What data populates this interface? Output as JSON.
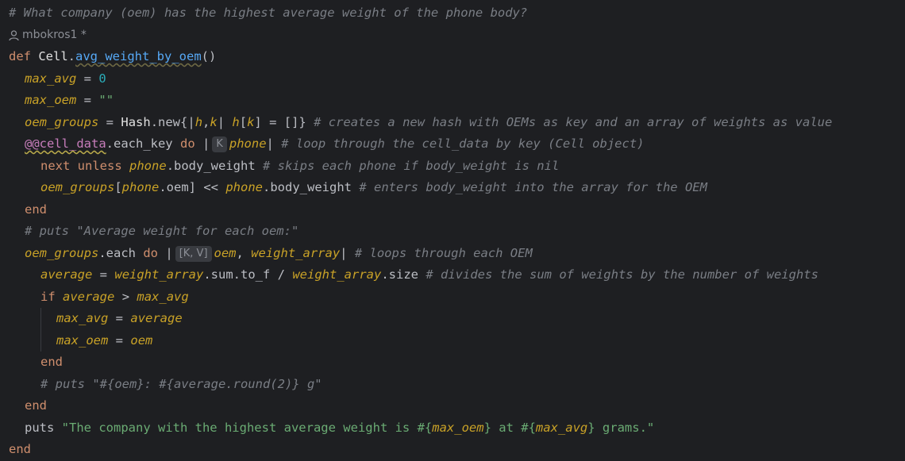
{
  "code": {
    "question_comment": "# What company (oem) has the highest average weight of the phone body?",
    "author": "mbokros1 *",
    "def_kw": "def",
    "def_class": "Cell",
    "def_method": "avg_weight_by_oem",
    "def_parens": "()",
    "max_avg_var": "max_avg",
    "max_avg_init": "0",
    "max_oem_var": "max_oem",
    "max_oem_init": "\"\"",
    "oem_groups_var": "oem_groups",
    "hash_class": "Hash",
    "hash_new": ".new{|",
    "h": "h",
    "k": "k",
    "hash_body_close": "] = []}",
    "hash_comment": "# creates a new hash with OEMs as key and an array of weights as value",
    "cell_data_ivar": "@@cell_data",
    "each_key": ".each_key",
    "do_kw": "do",
    "hint_k": "K",
    "phone_param": "phone",
    "cell_data_comment": "# loop through the cell_data by key (Cell object)",
    "next_kw": "next",
    "unless_kw": "unless",
    "phone": "phone",
    "body_weight": ".body_weight",
    "skip_comment": "# skips each phone if body_weight is nil",
    "oem_call": ".oem",
    "shovel": "] <<",
    "enter_comment": "# enters body_weight into the array for the OEM",
    "end_kw": "end",
    "puts_comment": "# puts \"Average weight for each oem:\"",
    "each": ".each",
    "hint_kv": "[K, V]",
    "oem_param": "oem",
    "weight_array": "weight_array",
    "loop_comment": "# loops through each OEM",
    "average_var": "average",
    "sum_to_f": ".sum.to_f /",
    "size": ".size",
    "divide_comment": "# divides the sum of weights by the number of weights",
    "if_kw": "if",
    "gt": ">",
    "eq": "=",
    "round_comment": "# puts \"#{oem}: #{average.round(2)} g\"",
    "puts": "puts",
    "msg_part1": "\"The company with the highest average weight is #{",
    "msg_part2": "} at #{",
    "msg_part3": "} grams.\""
  }
}
